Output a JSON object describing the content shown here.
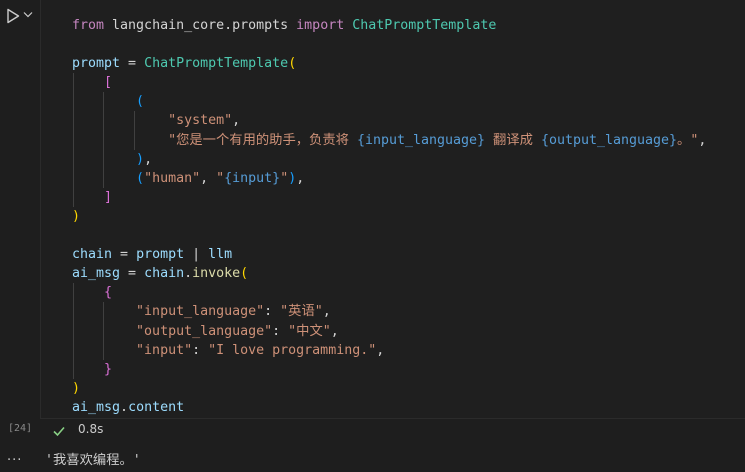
{
  "cell": {
    "execution_count": "[24]",
    "duration": "0.8s",
    "lines": [
      [
        {
          "t": "from",
          "c": "kw"
        },
        {
          "t": " langchain_core.prompts ",
          "c": "p"
        },
        {
          "t": "import",
          "c": "kw"
        },
        {
          "t": " ",
          "c": "p"
        },
        {
          "t": "ChatPromptTemplate",
          "c": "cl"
        }
      ],
      [],
      [
        {
          "t": "prompt",
          "c": "v"
        },
        {
          "t": " = ",
          "c": "p"
        },
        {
          "t": "ChatPromptTemplate",
          "c": "cl"
        },
        {
          "t": "(",
          "c": "b1"
        }
      ],
      [
        {
          "t": "    ",
          "c": "p"
        },
        {
          "t": "[",
          "c": "b2"
        }
      ],
      [
        {
          "t": "        ",
          "c": "p"
        },
        {
          "t": "(",
          "c": "b3"
        }
      ],
      [
        {
          "t": "            ",
          "c": "p"
        },
        {
          "t": "\"system\"",
          "c": "s"
        },
        {
          "t": ",",
          "c": "p"
        }
      ],
      [
        {
          "t": "            ",
          "c": "p"
        },
        {
          "t": "\"您是一个有用的助手，负责将 ",
          "c": "s"
        },
        {
          "t": "{input_language}",
          "c": "ph"
        },
        {
          "t": " 翻译成 ",
          "c": "s"
        },
        {
          "t": "{output_language}",
          "c": "ph"
        },
        {
          "t": "。\"",
          "c": "s"
        },
        {
          "t": ",",
          "c": "p"
        }
      ],
      [
        {
          "t": "        ",
          "c": "p"
        },
        {
          "t": ")",
          "c": "b3"
        },
        {
          "t": ",",
          "c": "p"
        }
      ],
      [
        {
          "t": "        ",
          "c": "p"
        },
        {
          "t": "(",
          "c": "b3"
        },
        {
          "t": "\"human\"",
          "c": "s"
        },
        {
          "t": ", ",
          "c": "p"
        },
        {
          "t": "\"",
          "c": "s"
        },
        {
          "t": "{input}",
          "c": "ph"
        },
        {
          "t": "\"",
          "c": "s"
        },
        {
          "t": ")",
          "c": "b3"
        },
        {
          "t": ",",
          "c": "p"
        }
      ],
      [
        {
          "t": "    ",
          "c": "p"
        },
        {
          "t": "]",
          "c": "b2"
        }
      ],
      [
        {
          "t": ")",
          "c": "b1"
        }
      ],
      [],
      [
        {
          "t": "chain",
          "c": "v"
        },
        {
          "t": " = ",
          "c": "p"
        },
        {
          "t": "prompt",
          "c": "v"
        },
        {
          "t": " | ",
          "c": "p"
        },
        {
          "t": "llm",
          "c": "v"
        }
      ],
      [
        {
          "t": "ai_msg",
          "c": "v"
        },
        {
          "t": " = ",
          "c": "p"
        },
        {
          "t": "chain",
          "c": "v"
        },
        {
          "t": ".",
          "c": "p"
        },
        {
          "t": "invoke",
          "c": "fn"
        },
        {
          "t": "(",
          "c": "b1"
        }
      ],
      [
        {
          "t": "    ",
          "c": "p"
        },
        {
          "t": "{",
          "c": "b2"
        }
      ],
      [
        {
          "t": "        ",
          "c": "p"
        },
        {
          "t": "\"input_language\"",
          "c": "s"
        },
        {
          "t": ": ",
          "c": "p"
        },
        {
          "t": "\"英语\"",
          "c": "s"
        },
        {
          "t": ",",
          "c": "p"
        }
      ],
      [
        {
          "t": "        ",
          "c": "p"
        },
        {
          "t": "\"output_language\"",
          "c": "s"
        },
        {
          "t": ": ",
          "c": "p"
        },
        {
          "t": "\"中文\"",
          "c": "s"
        },
        {
          "t": ",",
          "c": "p"
        }
      ],
      [
        {
          "t": "        ",
          "c": "p"
        },
        {
          "t": "\"input\"",
          "c": "s"
        },
        {
          "t": ": ",
          "c": "p"
        },
        {
          "t": "\"I love programming.\"",
          "c": "s"
        },
        {
          "t": ",",
          "c": "p"
        }
      ],
      [
        {
          "t": "    ",
          "c": "p"
        },
        {
          "t": "}",
          "c": "b2"
        }
      ],
      [
        {
          "t": ")",
          "c": "b1"
        }
      ],
      [
        {
          "t": "ai_msg",
          "c": "v"
        },
        {
          "t": ".",
          "c": "p"
        },
        {
          "t": "content",
          "c": "v"
        }
      ]
    ]
  },
  "output": {
    "more_label": "...",
    "text": "'我喜欢编程。'"
  },
  "colors": {
    "background": "#1e1e1e",
    "success": "#89d185",
    "keyword": "#c586c0",
    "string": "#ce9178",
    "variable": "#9cdcfe",
    "class": "#4ec9b0"
  },
  "icons": {
    "run": "run-cell-icon",
    "chevron": "chevron-down-icon",
    "status": "check-icon"
  }
}
